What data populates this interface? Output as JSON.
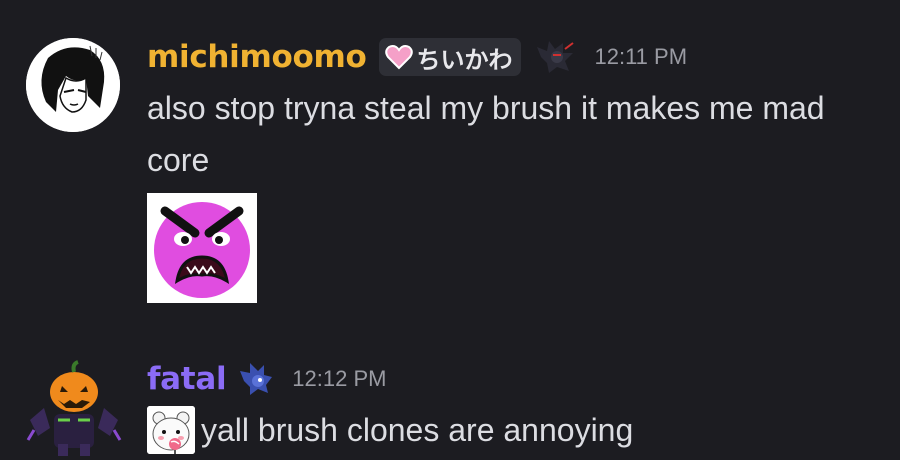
{
  "messages": [
    {
      "username": "michimoomo",
      "username_color": "#f0b232",
      "tag": {
        "icon": "pink-heart-icon",
        "text": "ちいかわ"
      },
      "badge_icon": "dark-hedgehog-icon",
      "timestamp": "12:11 PM",
      "avatar_icon": "manga-girl-avatar",
      "text": "also stop tryna steal my brush it makes me mad core",
      "sticker_icon": "angry-purple-face-icon"
    },
    {
      "username": "fatal",
      "username_color": "#8b6cf6",
      "badge_icon": "blue-hedgehog-icon",
      "timestamp": "12:12 PM",
      "avatar_icon": "pumpkin-robot-avatar",
      "inline_emoji_icon": "white-bear-lollipop-icon",
      "text": "yall brush clones are annoying"
    }
  ],
  "colors": {
    "background": "#1c1c21",
    "text": "#dcdde2",
    "timestamp": "#9a9ba3",
    "tag_bg": "#2e2f36"
  }
}
